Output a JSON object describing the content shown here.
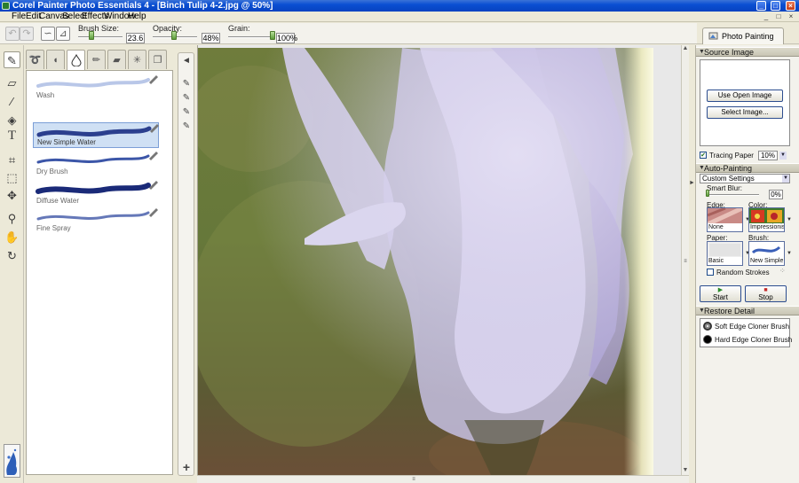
{
  "window": {
    "title": "Corel Painter Photo Essentials 4 - [Binch Tulip 4-2.jpg @ 50%]",
    "controls": [
      "_",
      "□",
      "×"
    ],
    "mdi_controls": [
      "_",
      "□",
      "×"
    ]
  },
  "menu": [
    "File",
    "Edit",
    "Canvas",
    "Select",
    "Effects",
    "Window",
    "Help"
  ],
  "propbar": {
    "brush_size_label": "Brush Size:",
    "brush_size_value": "23.6",
    "brush_size_fraction": 0.3,
    "opacity_label": "Opacity:",
    "opacity_value": "48%",
    "opacity_fraction": 0.48,
    "grain_label": "Grain:",
    "grain_value": "100%",
    "grain_fraction": 1.0
  },
  "right_tab": {
    "label": "Photo Painting"
  },
  "tools": [
    {
      "name": "brush-tool-icon",
      "glyph": "✎"
    },
    {
      "name": "eraser-tool-icon",
      "glyph": "▱"
    },
    {
      "name": "dropper-tool-icon",
      "glyph": "⁄"
    },
    {
      "name": "paint-bucket-tool-icon",
      "glyph": "◈"
    },
    {
      "name": "text-tool-icon",
      "glyph": "T"
    },
    {
      "name": "crop-tool-icon",
      "glyph": "⌗"
    },
    {
      "name": "rect-select-tool-icon",
      "glyph": "⬚"
    },
    {
      "name": "transform-tool-icon",
      "glyph": "✥"
    },
    {
      "name": "magnifier-tool-icon",
      "glyph": "⚲"
    },
    {
      "name": "grabber-hand-tool-icon",
      "glyph": "✋"
    },
    {
      "name": "rotate-page-tool-icon",
      "glyph": "↻"
    }
  ],
  "brush_tabs": [
    {
      "name": "tab-blender-icon",
      "glyph": "➰"
    },
    {
      "name": "tab-oils-icon",
      "glyph": "◖"
    },
    {
      "name": "tab-watercolor-icon",
      "glyph": "💧"
    },
    {
      "name": "tab-pencil-icon",
      "glyph": "✏"
    },
    {
      "name": "tab-chalk-icon",
      "glyph": "▰"
    },
    {
      "name": "tab-sparkle-icon",
      "glyph": "✳"
    },
    {
      "name": "tab-cloner-icon",
      "glyph": "❐"
    }
  ],
  "brushes": [
    {
      "label": "Wash",
      "color": "#b9c7e8",
      "width": 4,
      "selected": false
    },
    {
      "label": "New Simple Water",
      "color": "#2b3f8e",
      "width": 5,
      "selected": true
    },
    {
      "label": "Dry Brush",
      "color": "#3c56a8",
      "width": 3,
      "selected": false
    },
    {
      "label": "Diffuse Water",
      "color": "#1a2a78",
      "width": 6,
      "selected": false
    },
    {
      "label": "Fine Spray",
      "color": "#6578b8",
      "width": 3,
      "selected": false
    }
  ],
  "variants": [
    "✎",
    "✎",
    "✎",
    "✎"
  ],
  "variant_plus": "+",
  "variant_arrow": "◄",
  "source_image": {
    "title": "Source Image",
    "use_open_image": "Use Open Image",
    "select_image": "Select Image...",
    "tracing_paper_label": "Tracing Paper",
    "tracing_paper_checked": true,
    "tracing_value": "10%"
  },
  "auto_painting": {
    "title": "Auto-Painting",
    "preset": "Custom Settings",
    "smart_blur_label": "Smart Blur:",
    "smart_blur_value": "0%",
    "edge_label": "Edge:",
    "edge_value": "None",
    "color_label": "Color:",
    "color_value": "Impressionist",
    "paper_label": "Paper:",
    "paper_value": "Basic",
    "brush_label": "Brush:",
    "brush_value": "New Simple ...",
    "random_strokes_label": "Random Strokes",
    "random_strokes_checked": false,
    "start_label": "Start",
    "stop_label": "Stop"
  },
  "restore_detail": {
    "title": "Restore Detail",
    "soft_label": "Soft Edge Cloner Brush",
    "hard_label": "Hard Edge Cloner Brush"
  },
  "colors": {
    "titlebar": "#0a4fd2",
    "accent_green": "#5b9c3a",
    "selection_blue": "#cfe0f4"
  }
}
